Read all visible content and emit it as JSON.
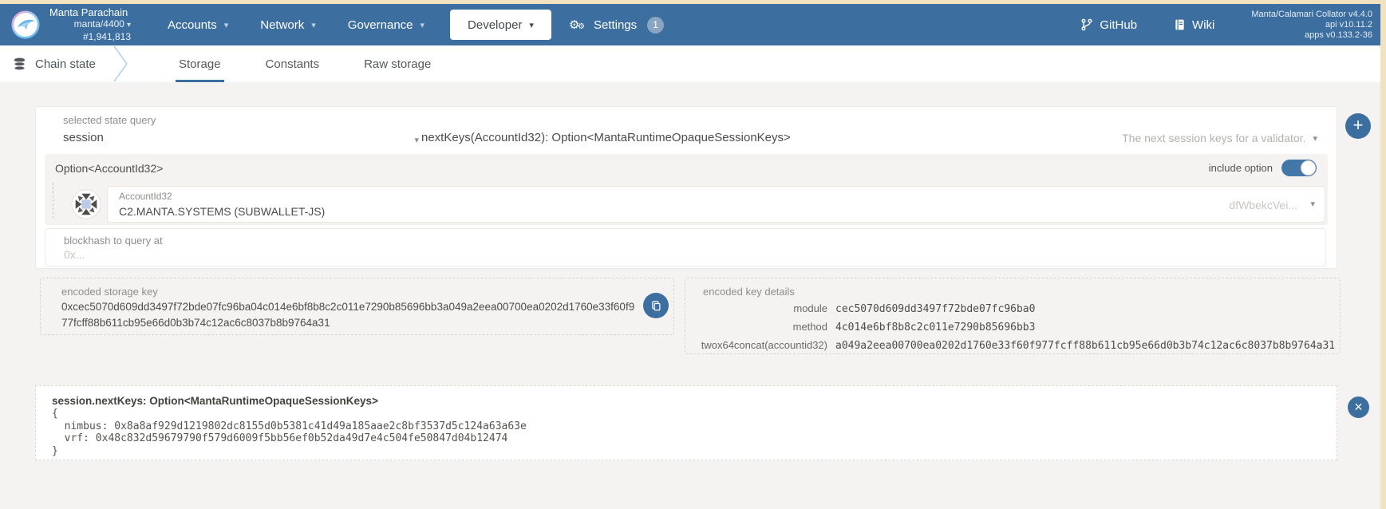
{
  "colors": {
    "header_bg": "#3c6e9f",
    "accent_blue": "#3c6e9f",
    "tab_underline": "#3b6fa0",
    "page_bg": "#f5f3f1",
    "edge_strip": "#f3e2c0",
    "toggle_on": "#4377a8",
    "settings_badge_bg": "#8aa6c2"
  },
  "header": {
    "chain_name": "Manta Parachain",
    "endpoint": "manta/4400",
    "block_number": "#1,941,813",
    "nav": [
      {
        "label": "Accounts"
      },
      {
        "label": "Network"
      },
      {
        "label": "Governance"
      },
      {
        "label": "Developer"
      }
    ],
    "settings_label": "Settings",
    "settings_badge": "1",
    "github_label": "GitHub",
    "wiki_label": "Wiki",
    "version_lines": [
      "Manta/Calamari Collator v4.4.0",
      "api v10.11.2",
      "apps v0.133.2-36"
    ]
  },
  "tabbar": {
    "section": "Chain state",
    "tabs": [
      {
        "label": "Storage"
      },
      {
        "label": "Constants"
      },
      {
        "label": "Raw storage"
      }
    ]
  },
  "query": {
    "label": "selected state query",
    "selected": "session",
    "signature": "nextKeys(AccountId32): Option<MantaRuntimeOpaqueSessionKeys>",
    "doc": "The next session keys for a validator.",
    "option_type": "Option<AccountId32>",
    "include_label": "include option",
    "include_on": true,
    "param_type": "AccountId32",
    "param_value": "C2.MANTA.SYSTEMS (SUBWALLET-JS)",
    "param_address": "dfWbekcVei...",
    "blockhash_label": "blockhash to query at",
    "blockhash_placeholder": "0x..."
  },
  "encoded_key": {
    "label": "encoded storage key",
    "value": "0xcec5070d609dd3497f72bde07fc96ba04c014e6bf8b8c2c011e7290b85696bb3a049a2eea00700ea0202d1760e33f60f977fcff88b611cb95e66d0b3b74c12ac6c8037b8b9764a31"
  },
  "key_details": {
    "label": "encoded key details",
    "rows": [
      {
        "name": "module",
        "value": "cec5070d609dd3497f72bde07fc96ba0"
      },
      {
        "name": "method",
        "value": "4c014e6bf8b8c2c011e7290b85696bb3"
      },
      {
        "name": "twox64concat(accountid32)",
        "value": "a049a2eea00700ea0202d1760e33f60f977fcff88b611cb95e66d0b3b74c12ac6c8037b8b9764a31"
      }
    ]
  },
  "result": {
    "title": "session.nextKeys: Option<MantaRuntimeOpaqueSessionKeys>",
    "lines": [
      "{",
      "  nimbus: 0x8a8af929d1219802dc8155d0b5381c41d49a185aae2c8bf3537d5c124a63a63e",
      "  vrf: 0x48c832d59679790f579d6009f5bb56ef0b52da49d7e4c504fe50847d04b12474",
      "}"
    ]
  }
}
